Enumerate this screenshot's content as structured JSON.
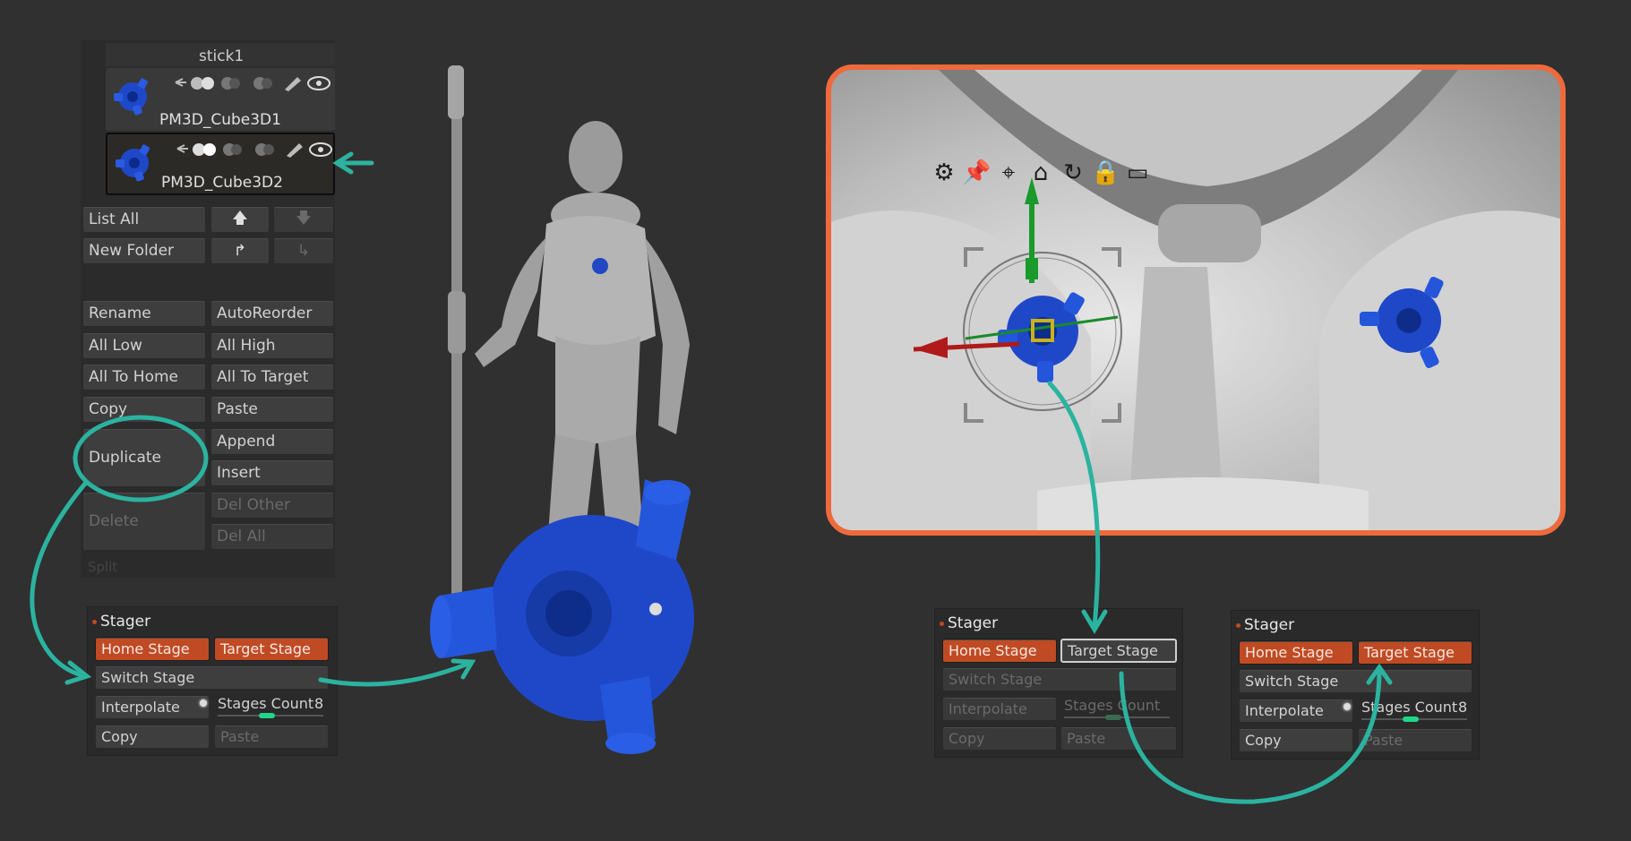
{
  "subtool_list": {
    "items": [
      {
        "label": "stick1"
      },
      {
        "label": "PM3D_Cube3D1"
      },
      {
        "label": "PM3D_Cube3D2",
        "selected": true
      }
    ]
  },
  "subtool_buttons": {
    "list_all": "List All",
    "new_folder": "New Folder",
    "rename": "Rename",
    "auto_reorder": "AutoReorder",
    "all_low": "All Low",
    "all_high": "All High",
    "all_to_home": "All To Home",
    "all_to_target": "All To Target",
    "copy": "Copy",
    "paste": "Paste",
    "duplicate": "Duplicate",
    "append": "Append",
    "insert": "Insert",
    "delete": "Delete",
    "del_other": "Del Other",
    "del_all": "Del All",
    "split": "Split"
  },
  "stagers": [
    {
      "title": "Stager",
      "home_stage": "Home Stage",
      "target_stage": "Target Stage",
      "switch_stage": "Switch Stage",
      "interpolate": "Interpolate",
      "stages_count_label": "Stages Count",
      "stages_count_value": "8",
      "copy": "Copy",
      "paste": "Paste"
    },
    {
      "title": "Stager",
      "home_stage": "Home Stage",
      "target_stage": "Target Stage",
      "switch_stage": "Switch Stage",
      "interpolate": "Interpolate",
      "stages_count_label": "Stages Count",
      "copy": "Copy",
      "paste": "Paste"
    },
    {
      "title": "Stager",
      "home_stage": "Home Stage",
      "target_stage": "Target Stage",
      "switch_stage": "Switch Stage",
      "interpolate": "Interpolate",
      "stages_count_label": "Stages Count",
      "stages_count_value": "8",
      "copy": "Copy",
      "paste": "Paste"
    }
  ],
  "gizmo_icons": [
    "gear-icon",
    "pin-icon",
    "location-pin-icon",
    "home-icon",
    "reset-icon",
    "lock-icon",
    "minus-bar-icon"
  ],
  "colors": {
    "background": "#303030",
    "accent_orange": "#c04a23",
    "viewport_border": "#ee6a3c",
    "annotation_teal": "#2bb3a0",
    "model_blue": "#1f48c9",
    "slider_green": "#1fd68a"
  }
}
